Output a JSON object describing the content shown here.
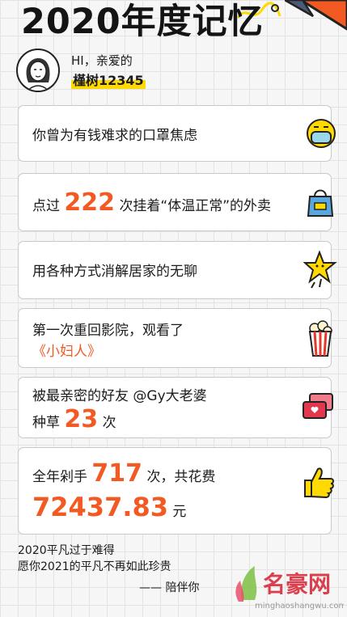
{
  "header": {
    "title": "2020年度记忆"
  },
  "profile": {
    "greeting": "HI，亲爱的",
    "username": "槿树12345"
  },
  "cards": [
    {
      "text": "你曾为有钱难求的口罩焦虑",
      "icon": "mask-icon"
    },
    {
      "prefix": "点过",
      "number": "222",
      "suffix": "次挂着“体温正常”的外卖",
      "icon": "delivery-bag-icon"
    },
    {
      "text": "用各种方式消解居家的无聊",
      "icon": "star-icon"
    },
    {
      "line1": "第一次重回影院，观看了",
      "line2": "《小妇人》",
      "icon": "popcorn-icon"
    },
    {
      "line1": "被最亲密的好友 @Gy大老婆",
      "prefix": "种草",
      "number": "23",
      "suffix": "次",
      "icon": "chat-bubble-icon"
    },
    {
      "prefix": "全年剁手",
      "number": "717",
      "suffix": "次，共花费",
      "amount": "72437.83",
      "unit": "元",
      "icon": "thumbs-up-icon"
    }
  ],
  "footer": {
    "line1": "2020平凡过于难得",
    "line2": "愿你2021的平凡不再如此珍贵",
    "line3": "—— 陪伴你"
  },
  "watermark": {
    "name": "名豪网",
    "url": "minghaoshangwu.com"
  },
  "colors": {
    "accent": "#f35a23",
    "highlight": "#ffd900",
    "grid": "#e3e3e3"
  }
}
